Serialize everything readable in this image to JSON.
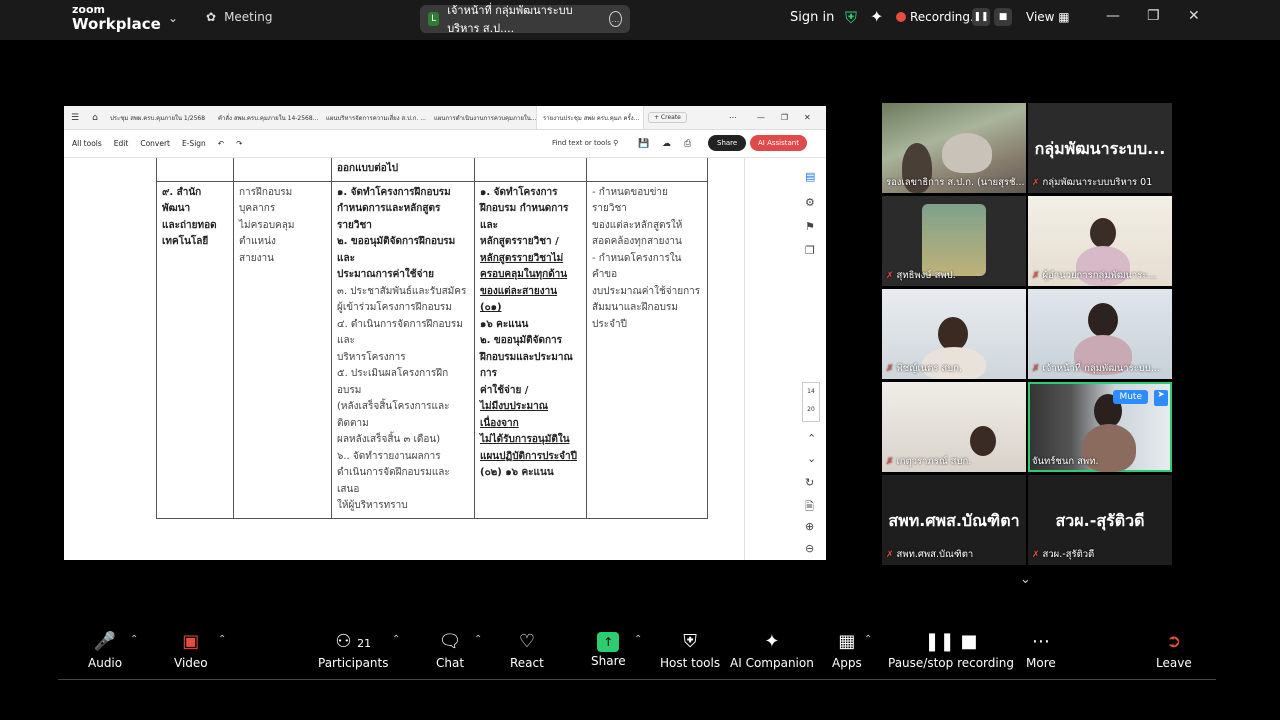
{
  "app": {
    "brand_small": "zoom",
    "brand_big": "Workplace",
    "meeting_label": "Meeting",
    "center_title": "เจ้าหน้าที่ กลุ่มพัฒนาระบบบริหาร ส.ป....",
    "sign_in": "Sign in",
    "recording_label": "Recording...",
    "view_label": "View"
  },
  "shared_doc": {
    "tabs": [
      "ประชุม สพผ.ครบ.คุมภายใน 1/2568",
      "คำสั่ง สพผ.ครบ.คุมภายใน 14-2568...",
      "แผนบริหารจัดการความเสี่ยง ส.ป.ก. ...",
      "แผนการดำเนินงานการควบคุมภายใน...",
      "รายงานประชุม สพผ ครบ.คุมภ ครั้ง..."
    ],
    "create_label": "+ Create",
    "toolbar": [
      "All tools",
      "Edit",
      "Convert",
      "E-Sign"
    ],
    "find_label": "Find text or tools",
    "share_btn": "Share",
    "ai_btn": "AI Assistant",
    "page_num": "14",
    "page_total": "20",
    "table": {
      "header_cont": "ออกแบบต่อไป",
      "col1": [
        "๙. สำนักพัฒนา",
        "และถ่ายทอด",
        "เทคโนโลยี"
      ],
      "col2": [
        "การฝึกอบรมบุคลากร",
        "ไม่ครอบคลุมตำแหน่ง",
        "สายงาน"
      ],
      "col3_bold": [
        "๑. จัดทำโครงการฝึกอบรม",
        "กำหนดการและหลักสูตรรายวิชา",
        "๒. ขออนุมัติจัดการฝึกอบรมและ",
        "ประมาณการค่าใช้จ่าย"
      ],
      "col3_rest": [
        "๓. ประชาสัมพันธ์และรับสมัคร",
        "ผู้เข้าร่วมโครงการฝึกอบรม",
        "๔. ดำเนินการจัดการฝึกอบรมและ",
        "บริหารโครงการ",
        "๕. ประเมินผลโครงการฝึกอบรม",
        "(หลังเสร็จสิ้นโครงการและติดตาม",
        "ผลหลังเสร็จสิ้น ๓ เดือน)",
        "๖.. จัดทำรายงานผลการ",
        "ดำเนินการจัดฝึกอบรมและเสนอ",
        "ให้ผู้บริหารทราบ"
      ],
      "col4": [
        "๑. จัดทำโครงการ",
        "ฝึกอบรม กำหนดการและ",
        "หลักสูตรรายวิชา /",
        "หลักสูตรรายวิชาไม่",
        "ครอบคลุมในทุกด้าน",
        "ของแต่ละสายงาน (๐๑)",
        "๑๖ คะแนน",
        "๒. ขออนุมัติจัดการ",
        "ฝึกอบรมและประมาณการ",
        "ค่าใช้จ่าย /",
        "ไม่มีงบประมาณเนื่องจาก",
        "ไม่ได้รับการอนุมัติใน",
        "แผนปฏิบัติการประจำปี",
        "(๐๒) ๑๖ คะแนน"
      ],
      "col5": [
        "- กำหนดขอบข่ายรายวิชา",
        "ของแต่ละหลักสูตรให้",
        "สอดคล้องทุกสายงาน",
        "- กำหนดโครงการในคำขอ",
        "งบประมาณค่าใช้จ่ายการ",
        "สัมมนาและฝึกอบรม",
        "ประจำปี"
      ]
    }
  },
  "participants": [
    {
      "name": "รองเลขาธิการ ส.ป.ก. (นายสุรชั...",
      "muted": false
    },
    {
      "name": "กลุ่มพัฒนาระบบบริหาร 01",
      "big": "กลุ่มพัฒนาระบบ...",
      "muted": true
    },
    {
      "name": "สุทธิพงษ์ สพป.",
      "muted": true
    },
    {
      "name": "ผู้อำนวยการกลุ่มพัฒนาระ...",
      "muted": true
    },
    {
      "name": "พิชญ์เนตร สบก.",
      "muted": true
    },
    {
      "name": "เจ้าหน้าที่ กลุ่มพัฒนาระบบ...",
      "muted": true
    },
    {
      "name": "เกตุวราภรณ์ สบก.",
      "muted": true
    },
    {
      "name": "จันทร์ชนก สพท.",
      "muted": false,
      "mute_btn": "Mute"
    },
    {
      "name": "สพท.ศพส.บัณฑิตา",
      "big": "สพท.ศพส.บัณฑิตา",
      "muted": true
    },
    {
      "name": "สวผ.-สุรัติวดี",
      "big": "สวผ.-สุรัติวดี",
      "muted": true
    }
  ],
  "bottom": {
    "audio": "Audio",
    "video": "Video",
    "participants": "Participants",
    "participants_count": "21",
    "chat": "Chat",
    "react": "React",
    "share": "Share",
    "host_tools": "Host tools",
    "ai_companion": "AI Companion",
    "apps": "Apps",
    "pause_stop": "Pause/stop recording",
    "more": "More",
    "leave": "Leave"
  }
}
